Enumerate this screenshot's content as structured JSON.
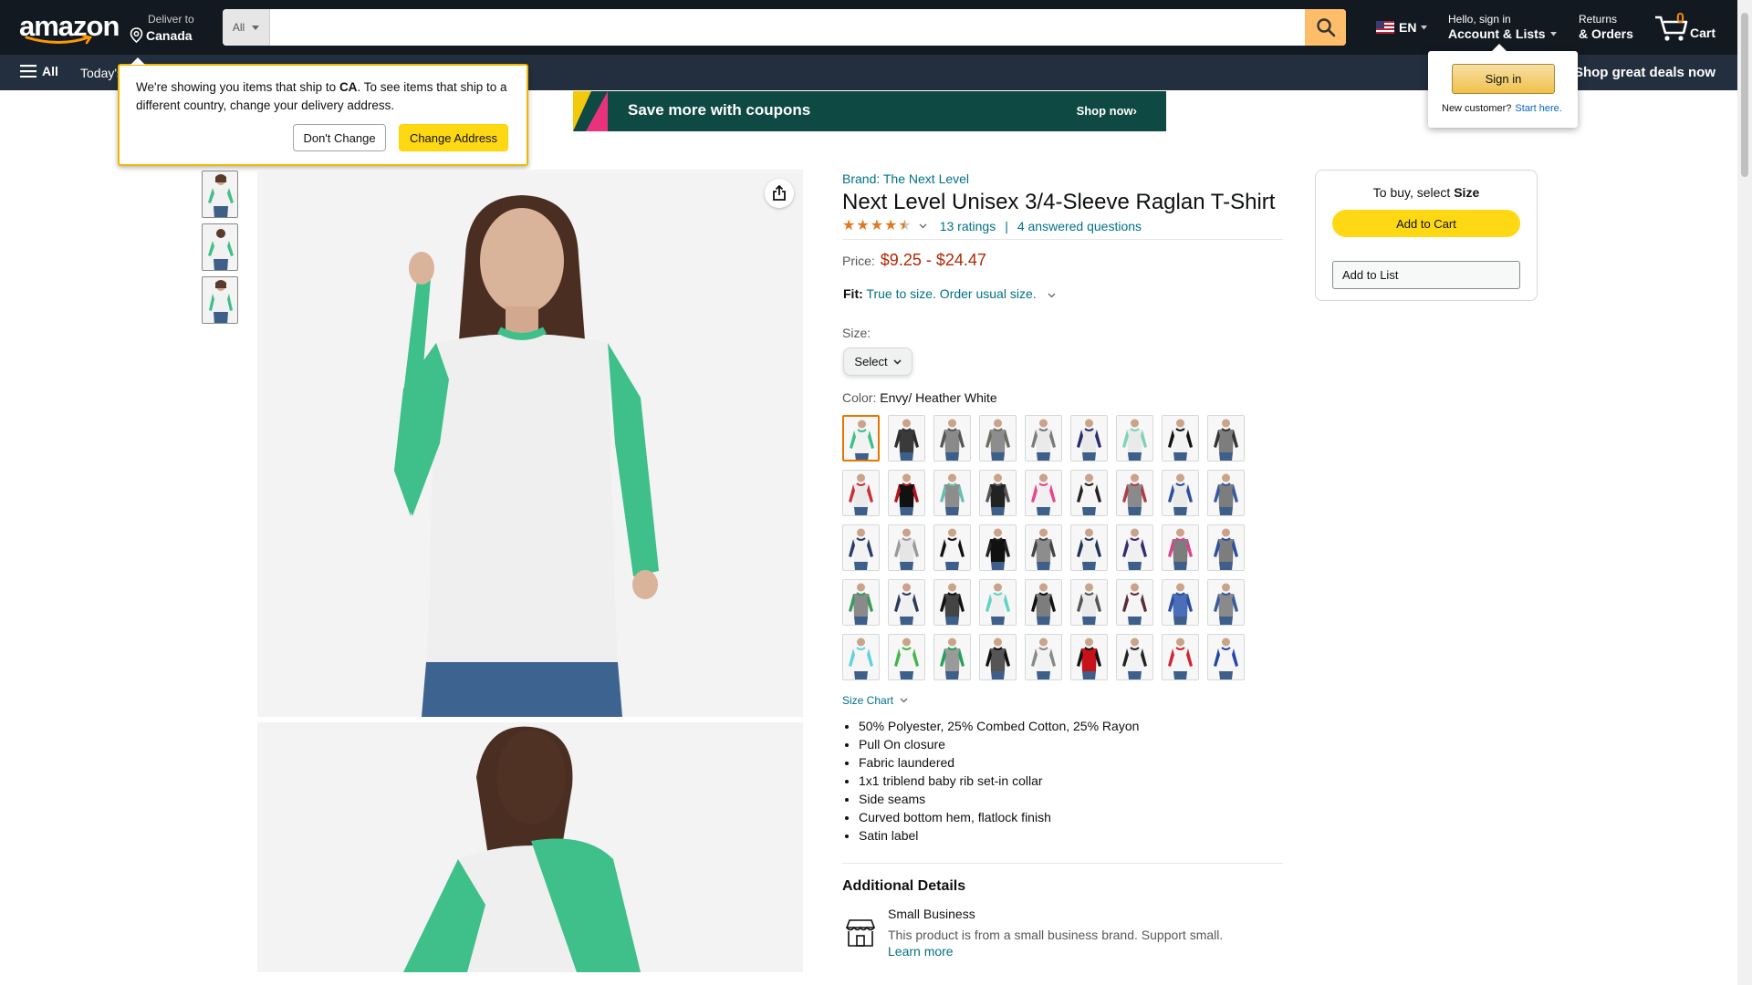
{
  "header": {
    "logo_text": "amazon",
    "deliver_line1": "Deliver to",
    "deliver_line2": "Canada",
    "search_category": "All",
    "search_placeholder": "",
    "language": "EN",
    "account_line1": "Hello, sign in",
    "account_line2": "Account & Lists",
    "returns_line1": "Returns",
    "returns_line2": "& Orders",
    "cart_count": "0",
    "cart_label": "Cart"
  },
  "subnav": {
    "all_label": "All",
    "today_label": "Today's",
    "deals_label": "Shop great deals now"
  },
  "address_popover": {
    "text_before": "We're showing you items that ship to ",
    "country": "CA",
    "text_after": ". To see items that ship to a different country, change your delivery address.",
    "dont_change_label": "Don't Change",
    "change_address_label": "Change Address"
  },
  "signin_popover": {
    "button_label": "Sign in",
    "new_customer": "New customer?",
    "start_here": "Start here."
  },
  "banner": {
    "text": "Save more with coupons",
    "cta": "Shop now›"
  },
  "product": {
    "brand": "Brand: The Next Level",
    "title": "Next Level Unisex 3/4-Sleeve Raglan T-Shirt",
    "rating_value": 4.5,
    "ratings_count": "13 ratings",
    "separator": "|",
    "questions": "4 answered questions",
    "price_label": "Price:",
    "price_range": "$9.25 - $24.47",
    "fit_label": "Fit:",
    "fit_value": "True to size. Order usual size.",
    "size_label": "Size:",
    "size_select": "Select",
    "color_label": "Color:",
    "color_value": "Envy/ Heather White",
    "size_chart": "Size Chart",
    "bullets": [
      "50% Polyester, 25% Combed Cotton, 25% Rayon",
      "Pull On closure",
      "Fabric laundered",
      "1x1 triblend baby rib set-in collar",
      "Side seams",
      "Curved bottom hem, flatlock finish",
      "Satin label"
    ],
    "additional_title": "Additional Details",
    "small_business_title": "Small Business",
    "small_business_text": "This product is from a small business brand. Support small.",
    "learn_more": "Learn more"
  },
  "buybox": {
    "hint_prefix": "To buy, select ",
    "hint_bold": "Size",
    "add_to_cart": "Add to Cart",
    "add_to_list": "Add to List"
  },
  "colors": {
    "nav_bg": "#131921",
    "subnav_bg": "#232f3e",
    "accent_orange": "#febd69",
    "link": "#007185",
    "price": "#b12704",
    "button_yellow": "#ffd814",
    "swatches": [
      [
        "#3fbf8a",
        "#f2f2f2"
      ],
      [
        "#2e2e2e",
        "#3a3a3a"
      ],
      [
        "#555",
        "#8a8a8a"
      ],
      [
        "#6b6e5c",
        "#8d8d8d"
      ],
      [
        "#7a7a7a",
        "#eaeaea"
      ],
      [
        "#2c2a6e",
        "#eaeaea"
      ],
      [
        "#7dd3b8",
        "#eaeaea"
      ],
      [
        "#111",
        "#f2f2f2"
      ],
      [
        "#333",
        "#7d7d7d"
      ],
      [
        "#c8313a",
        "#eaeaea"
      ],
      [
        "#b3121b",
        "#111"
      ],
      [
        "#6bbfb0",
        "#8d8d8d"
      ],
      [
        "#555",
        "#222"
      ],
      [
        "#e8468f",
        "#f0f0f0"
      ],
      [
        "#222",
        "#f5f5f5"
      ],
      [
        "#b33a4a",
        "#8a8a8a"
      ],
      [
        "#2c4f9e",
        "#eaeaea"
      ],
      [
        "#375aa0",
        "#7d7d7d"
      ],
      [
        "#2b3a67",
        "#f2f2f2"
      ],
      [
        "#9a9a9a",
        "#e6e6e6"
      ],
      [
        "#111",
        "#f5f5f5"
      ],
      [
        "#222",
        "#111"
      ],
      [
        "#444",
        "#8d8d8d"
      ],
      [
        "#1f3555",
        "#f0f0f0"
      ],
      [
        "#3a2a6e",
        "#f0f0f0"
      ],
      [
        "#d6448d",
        "#7d7d7d"
      ],
      [
        "#2c4f9e",
        "#7d7d7d"
      ],
      [
        "#3a9a5c",
        "#8a8a8a"
      ],
      [
        "#2c3a5e",
        "#f0f0f0"
      ],
      [
        "#111",
        "#444"
      ],
      [
        "#5fd3c9",
        "#f0f0f0"
      ],
      [
        "#111",
        "#7d7d7d"
      ],
      [
        "#555",
        "#eaeaea"
      ],
      [
        "#5a2a3e",
        "#f5f5f5"
      ],
      [
        "#2c4f9e",
        "#4a6fb8"
      ],
      [
        "#3a5aa0",
        "#8a8a8a"
      ],
      [
        "#5ed3dc",
        "#f5f5f5"
      ],
      [
        "#43b649",
        "#f5f5f5"
      ],
      [
        "#23a05a",
        "#9a9a9a"
      ],
      [
        "#111",
        "#555"
      ],
      [
        "#888",
        "#f2f2f2"
      ],
      [
        "#111",
        "#c8121b"
      ],
      [
        "#222",
        "#f2f2f2"
      ],
      [
        "#cc2630",
        "#f5f5f5"
      ],
      [
        "#2347a8",
        "#f5f5f5"
      ]
    ]
  }
}
